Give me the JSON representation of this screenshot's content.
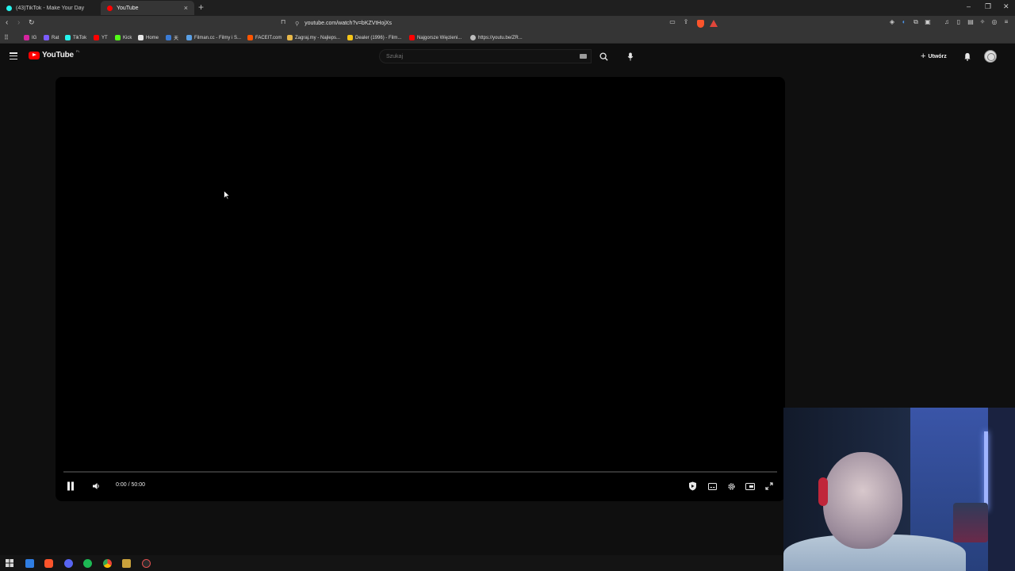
{
  "browser": {
    "tabs": [
      {
        "label": "(43)TikTok - Make Your Day",
        "icon": "tiktok-icon",
        "active": false
      },
      {
        "label": "YouTube",
        "icon": "youtube-icon",
        "active": true
      }
    ],
    "address": "youtube.com/watch?v=bKZVtHojXs",
    "bookmarks": [
      {
        "label": "IG",
        "icon": "instagram-icon",
        "color": "#d6249f"
      },
      {
        "label": "Rat",
        "icon": "bookmark-icon",
        "color": "#7b5cff"
      },
      {
        "label": "TikTok",
        "icon": "tiktok-icon",
        "color": "#25f4ee"
      },
      {
        "label": "YT",
        "icon": "youtube-icon",
        "color": "#ff0000"
      },
      {
        "label": "Kick",
        "icon": "kick-icon",
        "color": "#53fc18"
      },
      {
        "label": "Home",
        "icon": "x-icon",
        "color": "#e7e7e7"
      },
      {
        "label": "天",
        "icon": "bookmark-icon",
        "color": "#3a7bd5"
      },
      {
        "label": "Filman.cc - Filmy i S...",
        "icon": "bookmark-icon",
        "color": "#5aa0e6"
      },
      {
        "label": "FACEIT.com",
        "icon": "faceit-icon",
        "color": "#ff5500"
      },
      {
        "label": "Zagraj.my - Najleps...",
        "icon": "bookmark-icon",
        "color": "#e8b84a"
      },
      {
        "label": "Dealer (1996) - Film...",
        "icon": "bookmark-icon",
        "color": "#f5c518"
      },
      {
        "label": "Najgorsze Więzieni...",
        "icon": "youtube-icon",
        "color": "#ff0000"
      },
      {
        "label": "https://youtu.be/ZR...",
        "icon": "globe-icon",
        "color": "#bdbdbd"
      }
    ]
  },
  "youtube": {
    "logo_text": "YouTube",
    "country_code": "PL",
    "search_placeholder": "Szukaj",
    "create_label": "Utwórz"
  },
  "player": {
    "time_display": "0:00 / 50:00",
    "progress_fraction": 0.0
  },
  "colors": {
    "youtube_red": "#ff0000",
    "page_background": "#0f0f0f",
    "brave_orange": "#fb542b"
  }
}
